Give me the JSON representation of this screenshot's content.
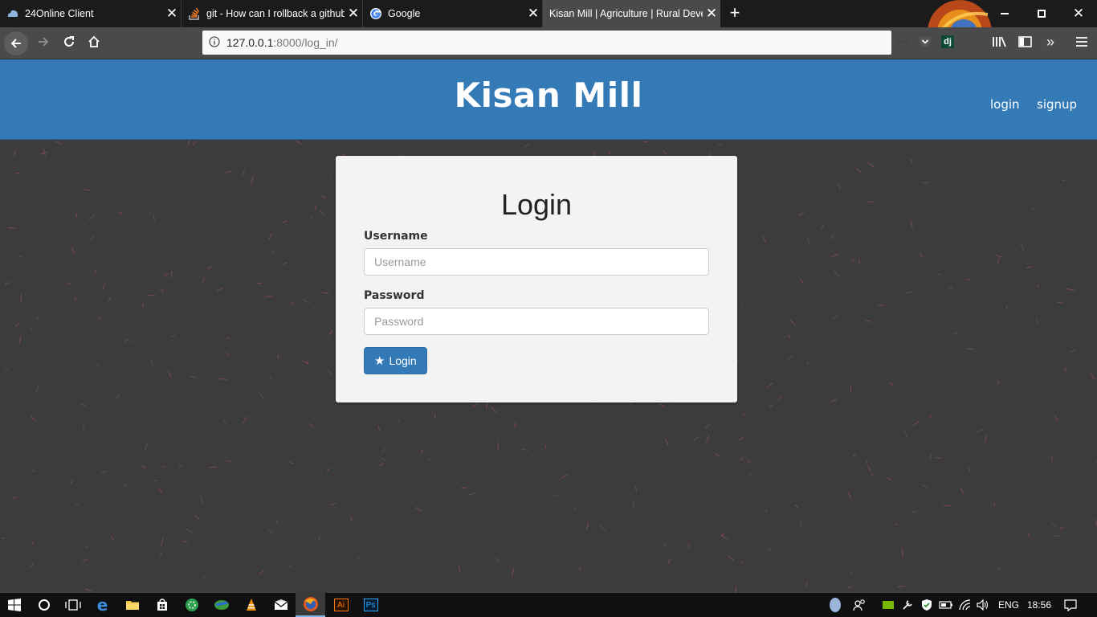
{
  "browser": {
    "tabs": [
      {
        "title": "24Online Client",
        "icon": "cloud-icon"
      },
      {
        "title": "git - How can I rollback a github",
        "icon": "stackoverflow-icon"
      },
      {
        "title": "Google",
        "icon": "google-icon"
      },
      {
        "title": "Kisan Mill | Agriculture | Rural Deve",
        "icon": "none",
        "active": true
      }
    ],
    "new_tab_label": "+",
    "url_host": "127.0.0.1",
    "url_rest": ":8000/log_in/",
    "toolbar_icons": [
      "page-actions-icon",
      "pocket-icon",
      "django-icon",
      "bookmark-star-icon",
      "library-icon",
      "sidebar-icon",
      "overflow-icon",
      "menu-icon"
    ]
  },
  "site": {
    "brand": "Kisan Mill",
    "nav": {
      "login": "login",
      "signup": "signup"
    }
  },
  "form": {
    "title": "Login",
    "username_label": "Username",
    "username_placeholder": "Username",
    "username_value": "",
    "password_label": "Password",
    "password_placeholder": "Password",
    "password_value": "",
    "submit_label": "Login"
  },
  "taskbar": {
    "language": "ENG",
    "time": "18:56"
  },
  "colors": {
    "header": "#337ab7",
    "page_bg": "#3c3b3d",
    "card_bg": "#f3f3f3",
    "button": "#337ab7"
  }
}
